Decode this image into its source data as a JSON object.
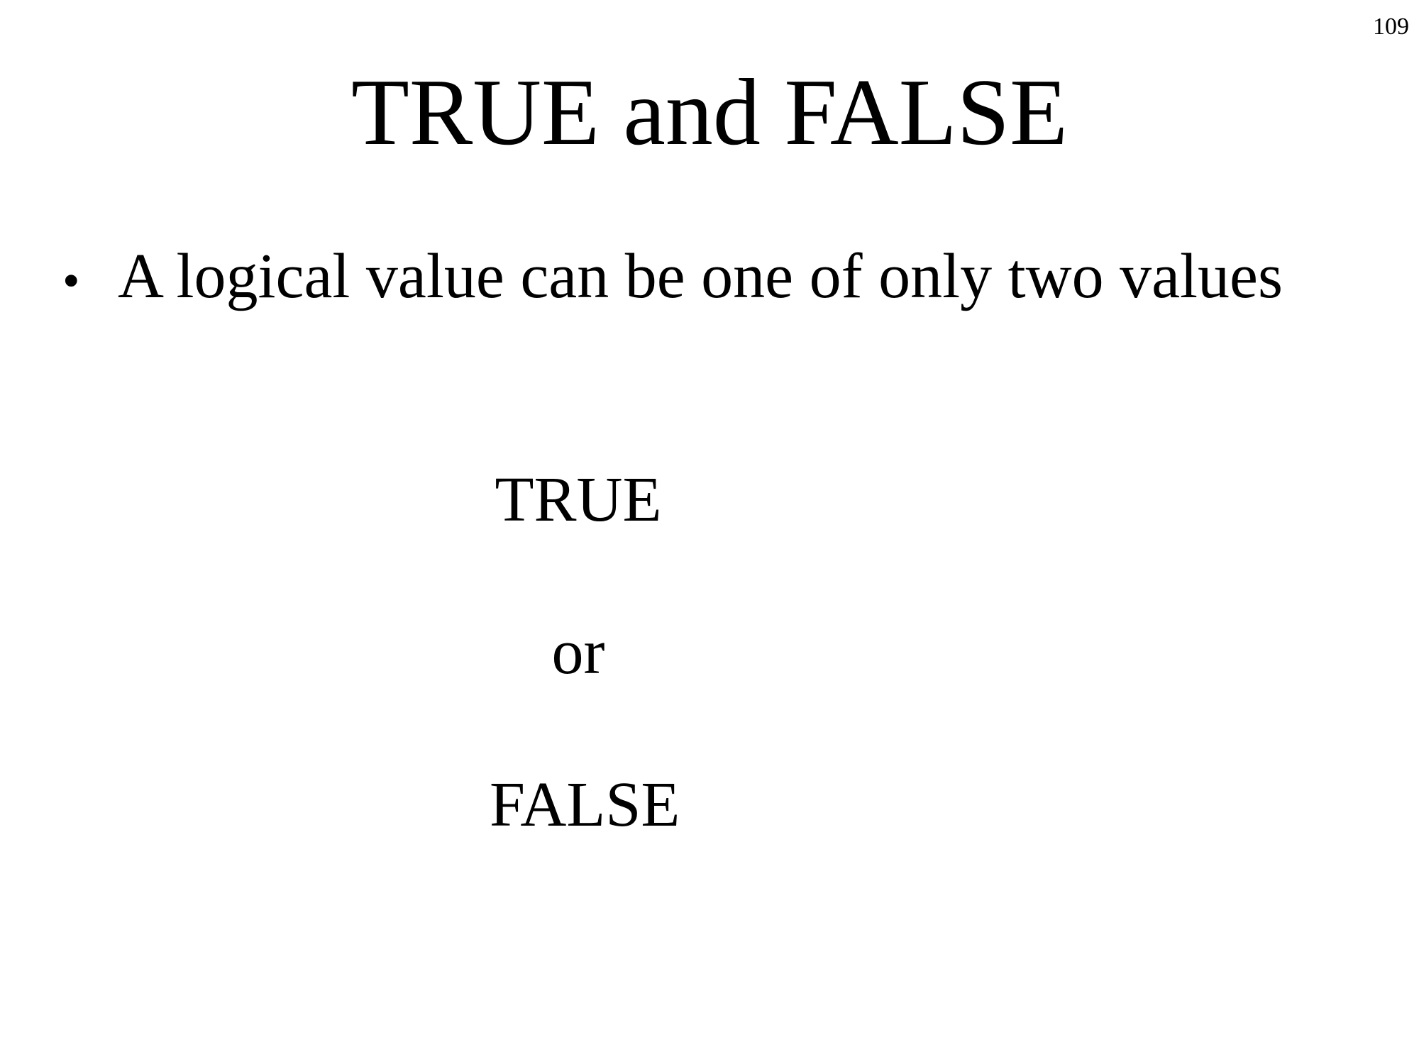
{
  "page_number": "109",
  "title": "TRUE and FALSE",
  "bullets": [
    {
      "symbol": "•",
      "text": "A logical value can be one of only two values"
    }
  ],
  "values": {
    "first": "TRUE",
    "separator": "or",
    "second": "FALSE"
  }
}
